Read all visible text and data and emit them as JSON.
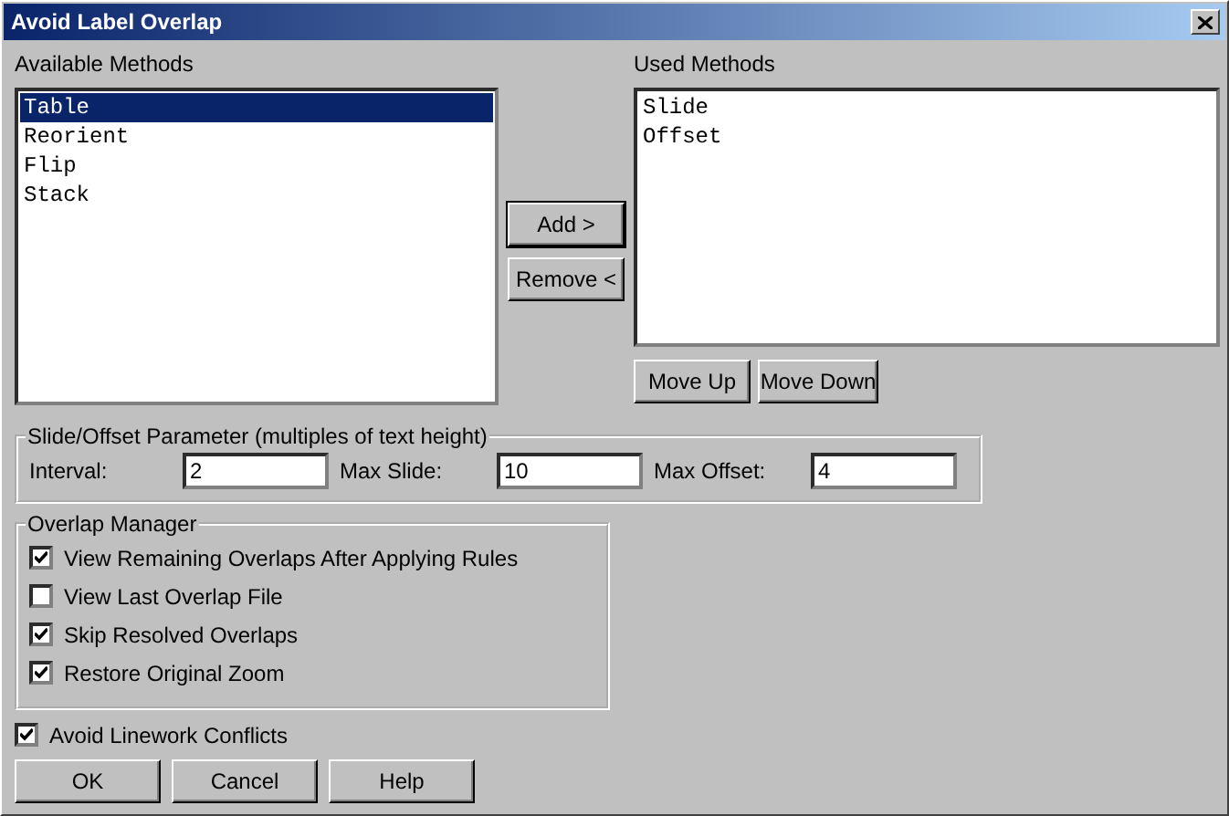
{
  "window": {
    "title": "Avoid Label Overlap"
  },
  "available_methods": {
    "label": "Available Methods",
    "items": [
      {
        "label": "Table",
        "selected": true
      },
      {
        "label": "Reorient",
        "selected": false
      },
      {
        "label": "Flip",
        "selected": false
      },
      {
        "label": "Stack",
        "selected": false
      }
    ]
  },
  "transfer_buttons": [
    "Add >",
    "Remove <"
  ],
  "used_methods": {
    "label": "Used Methods",
    "items": [
      {
        "label": "Slide",
        "selected": false
      },
      {
        "label": "Offset",
        "selected": false
      }
    ]
  },
  "order_buttons": [
    "Move Up",
    "Move Down"
  ],
  "slide_offset_parameter": {
    "legend": "Slide/Offset Parameter (multiples of text height)",
    "fields": [
      {
        "label": "Interval:",
        "value": "2"
      },
      {
        "label": "Max Slide:",
        "value": "10"
      },
      {
        "label": "Max Offset:",
        "value": "4"
      }
    ]
  },
  "overlap_manager": {
    "legend": "Overlap Manager",
    "options": [
      {
        "label": "View Remaining Overlaps After Applying Rules",
        "checked": true
      },
      {
        "label": "View Last Overlap File",
        "checked": false
      },
      {
        "label": "Skip Resolved Overlaps",
        "checked": true
      },
      {
        "label": "Restore Original Zoom",
        "checked": true
      }
    ]
  },
  "avoid_linework": {
    "label": "Avoid Linework Conflicts",
    "checked": true
  },
  "buttons": [
    "OK",
    "Cancel",
    "Help"
  ]
}
